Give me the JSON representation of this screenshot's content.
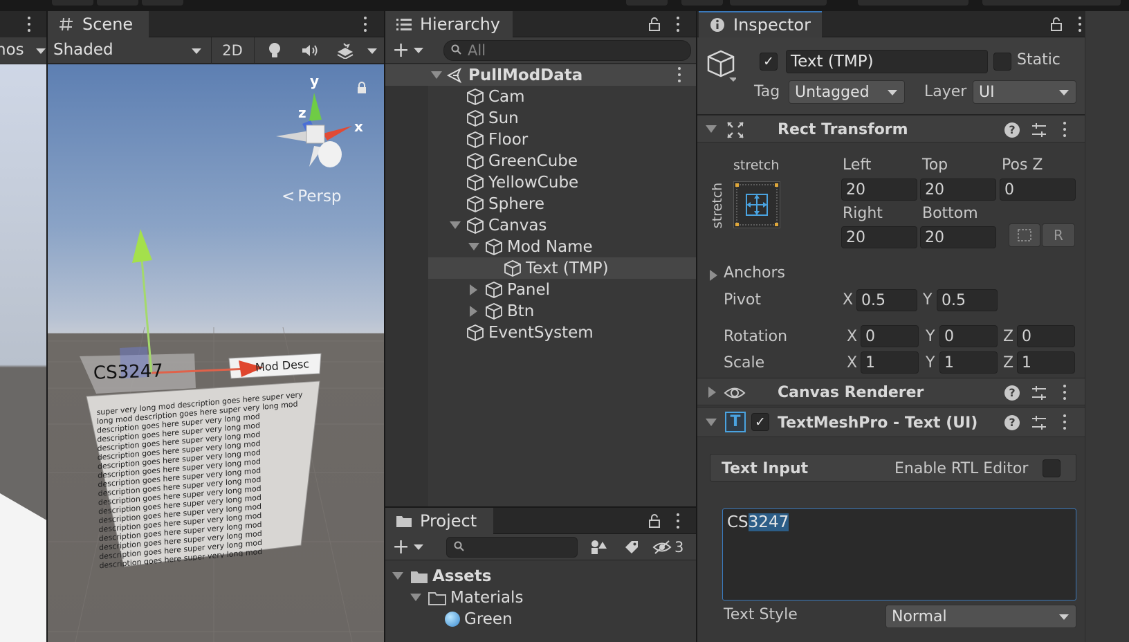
{
  "scene": {
    "tab_label": "Scene",
    "left_tab_fragment": "nos",
    "shading_mode": "Shaded",
    "btn_2d": "2D",
    "gizmo_y": "y",
    "gizmo_x": "x",
    "gizmo_z": "z",
    "projection_label": "Persp",
    "object_title_text": "CS3247",
    "object_desc_button_text": "Mod Desc",
    "description_text": "super very long mod description goes here super very long mod description goes here super very long mod description goes here super very long mod description goes here super very long mod description goes here super very long mod description goes here super very long mod description goes here super very long mod description goes here super very long mod description goes here super very long mod description goes here super very long mod description goes here super very long mod description goes here super very long mod description goes here super very long mod description goes here super very long mod description goes here super very long mod description goes here super very long mod description goes here super very long mod description goes here super very long mod description goes here super very long mod description goes here super very long mod description goes here"
  },
  "hierarchy": {
    "tab_label": "Hierarchy",
    "search_placeholder": "All",
    "root": "PullModData",
    "items": [
      {
        "label": "Cam"
      },
      {
        "label": "Sun"
      },
      {
        "label": "Floor"
      },
      {
        "label": "GreenCube"
      },
      {
        "label": "YellowCube"
      },
      {
        "label": "Sphere"
      },
      {
        "label": "Canvas"
      },
      {
        "label": "Mod Name"
      },
      {
        "label": "Text (TMP)"
      },
      {
        "label": "Panel"
      },
      {
        "label": "Btn"
      },
      {
        "label": "EventSystem"
      }
    ]
  },
  "project": {
    "tab_label": "Project",
    "hidden_count": "3",
    "tree": [
      {
        "label": "Assets"
      },
      {
        "label": "Materials"
      },
      {
        "label": "Green"
      }
    ]
  },
  "inspector": {
    "tab_label": "Inspector",
    "object_name": "Text (TMP)",
    "static_label": "Static",
    "tag_label": "Tag",
    "tag_value": "Untagged",
    "layer_label": "Layer",
    "layer_value": "UI",
    "rect_transform": {
      "title": "Rect Transform",
      "anchor_h": "stretch",
      "anchor_v": "stretch",
      "left_label": "Left",
      "top_label": "Top",
      "posz_label": "Pos Z",
      "left": "20",
      "top": "20",
      "posz": "0",
      "right_label": "Right",
      "bottom_label": "Bottom",
      "right": "20",
      "bottom": "20",
      "r_button": "R",
      "anchors_label": "Anchors",
      "pivot_label": "Pivot",
      "pivot_x_label": "X",
      "pivot_x": "0.5",
      "pivot_y_label": "Y",
      "pivot_y": "0.5",
      "rotation_label": "Rotation",
      "rot_x": "0",
      "rot_y": "0",
      "rot_z": "0",
      "scale_label": "Scale",
      "scale_x": "1",
      "scale_y": "1",
      "scale_z": "1",
      "x": "X",
      "y": "Y",
      "z": "Z"
    },
    "canvas_renderer": {
      "title": "Canvas Renderer"
    },
    "tmp": {
      "title": "TextMeshPro - Text (UI)",
      "text_input_label": "Text Input",
      "rtl_label": "Enable RTL Editor",
      "text_value_plain": "CS",
      "text_value_selected": "3247",
      "text_style_label": "Text Style",
      "text_style_value": "Normal"
    }
  },
  "colors": {
    "accent": "#3a79bb",
    "selection": "#2c5d87",
    "sky_top": "#5d7fb2",
    "ground": "#6e6a66"
  }
}
